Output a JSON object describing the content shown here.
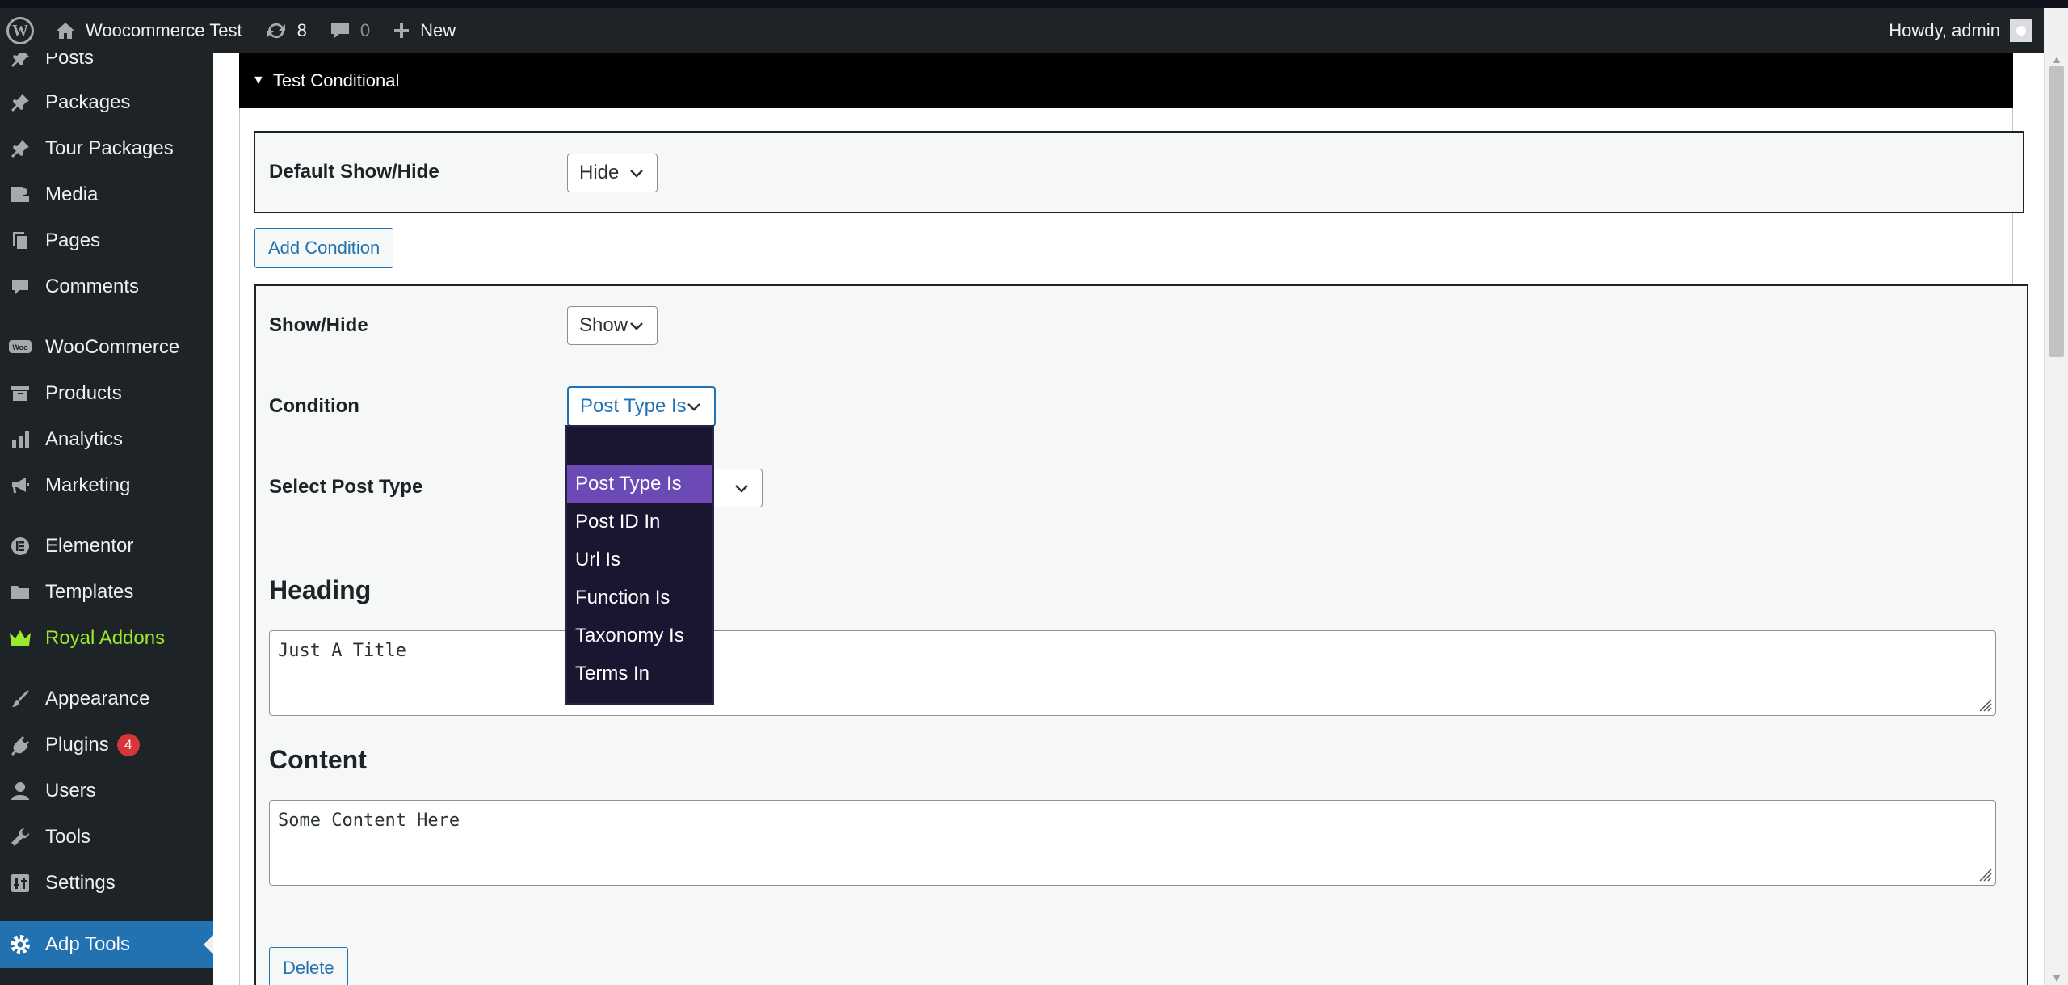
{
  "adminbar": {
    "site_name": "Woocommerce Test",
    "updates_count": "8",
    "comments_count": "0",
    "new_label": "New",
    "howdy": "Howdy, admin"
  },
  "sidebar": {
    "items": [
      {
        "label": "Posts",
        "icon": "pin-icon"
      },
      {
        "label": "Packages",
        "icon": "pin-icon"
      },
      {
        "label": "Tour Packages",
        "icon": "pin-icon"
      },
      {
        "label": "Media",
        "icon": "media-icon"
      },
      {
        "label": "Pages",
        "icon": "pages-icon"
      },
      {
        "label": "Comments",
        "icon": "comment-icon"
      },
      {
        "label": "WooCommerce",
        "icon": "woo-icon"
      },
      {
        "label": "Products",
        "icon": "archive-icon"
      },
      {
        "label": "Analytics",
        "icon": "bar-chart-icon"
      },
      {
        "label": "Marketing",
        "icon": "megaphone-icon"
      },
      {
        "label": "Elementor",
        "icon": "elementor-icon"
      },
      {
        "label": "Templates",
        "icon": "folder-icon"
      },
      {
        "label": "Royal Addons",
        "icon": "crown-icon"
      },
      {
        "label": "Appearance",
        "icon": "brush-icon"
      },
      {
        "label": "Plugins",
        "icon": "plug-icon",
        "badge": "4"
      },
      {
        "label": "Users",
        "icon": "user-icon"
      },
      {
        "label": "Tools",
        "icon": "wrench-icon"
      },
      {
        "label": "Settings",
        "icon": "settings-icon"
      },
      {
        "label": "Adp Tools",
        "icon": "gear-icon"
      }
    ]
  },
  "panel": {
    "title": "Test Conditional",
    "default_show_hide_label": "Default Show/Hide",
    "default_show_hide_value": "Hide",
    "add_condition_label": "Add Condition",
    "show_hide_label": "Show/Hide",
    "show_hide_value": "Show",
    "condition_label": "Condition",
    "condition_value": "Post Type Is",
    "select_post_type_label": "Select Post Type",
    "condition_options": [
      "",
      "Post Type Is",
      "Post ID In",
      "Url Is",
      "Function Is",
      "Taxonomy Is",
      "Terms In"
    ],
    "heading_label": "Heading",
    "heading_value": "Just A Title",
    "content_label": "Content",
    "content_value": "Some Content Here",
    "delete_label": "Delete"
  },
  "colors": {
    "admin_bar": "#1d2327",
    "accent": "#2271b1",
    "royal": "#9aeb2a",
    "dropdown_bg": "#1a1530",
    "dropdown_selected": "#6c4ab6"
  }
}
